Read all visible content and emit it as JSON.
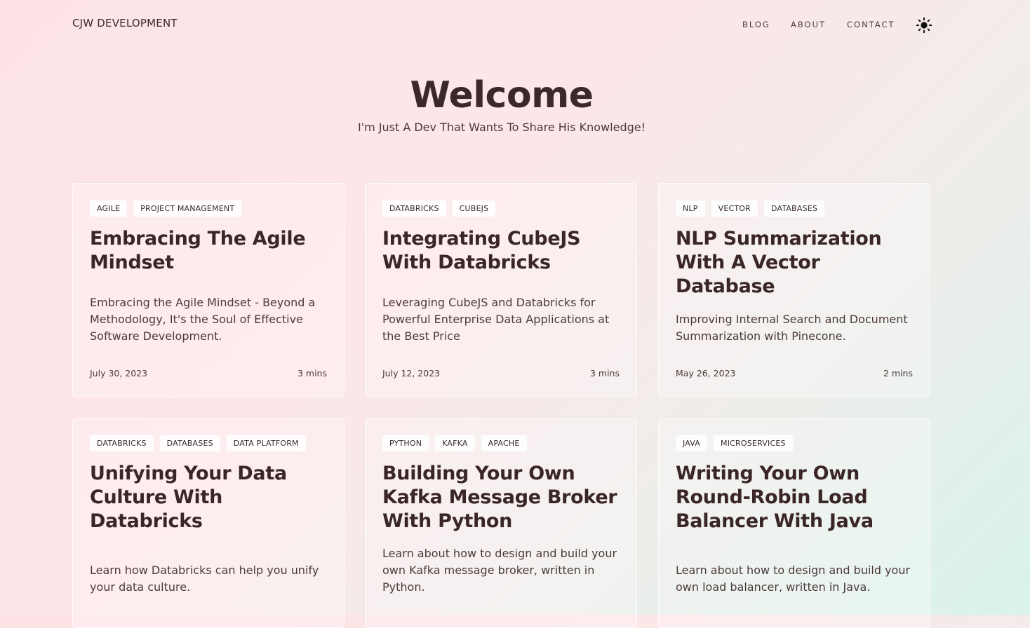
{
  "header": {
    "brand": "CJW DEVELOPMENT",
    "nav": {
      "blog": "BLOG",
      "about": "ABOUT",
      "contact": "CONTACT"
    },
    "theme_icon": "sun-icon"
  },
  "hero": {
    "title": "Welcome",
    "subtitle": "I'm Just A Dev That Wants To Share His Knowledge!"
  },
  "posts": [
    {
      "tags": [
        "AGILE",
        "PROJECT MANAGEMENT"
      ],
      "title": "Embracing The Agile Mindset",
      "description": "Embracing the Agile Mindset - Beyond a Methodology, It's the Soul of Effective Software Development.",
      "date": "July 30, 2023",
      "read_time": "3 mins"
    },
    {
      "tags": [
        "DATABRICKS",
        "CUBEJS"
      ],
      "title": "Integrating CubeJS With Databricks",
      "description": "Leveraging CubeJS and Databricks for Powerful Enterprise Data Applications at the Best Price",
      "date": "July 12, 2023",
      "read_time": "3 mins"
    },
    {
      "tags": [
        "NLP",
        "VECTOR",
        "DATABASES"
      ],
      "title": "NLP Summarization With A Vector Database",
      "description": "Improving Internal Search and Document Summarization with Pinecone.",
      "date": "May 26, 2023",
      "read_time": "2 mins"
    },
    {
      "tags": [
        "DATABRICKS",
        "DATABASES",
        "DATA PLATFORM"
      ],
      "title": "Unifying Your Data Culture With Databricks",
      "description": "Learn how Databricks can help you unify your data culture."
    },
    {
      "tags": [
        "PYTHON",
        "KAFKA",
        "APACHE"
      ],
      "title": "Building Your Own Kafka Message Broker With Python",
      "description": "Learn about how to design and build your own Kafka message broker, written in Python."
    },
    {
      "tags": [
        "JAVA",
        "MICROSERVICES"
      ],
      "title": "Writing Your Own Round-Robin Load Balancer With Java",
      "description": "Learn about how to design and build your own load balancer, written in Java."
    }
  ]
}
